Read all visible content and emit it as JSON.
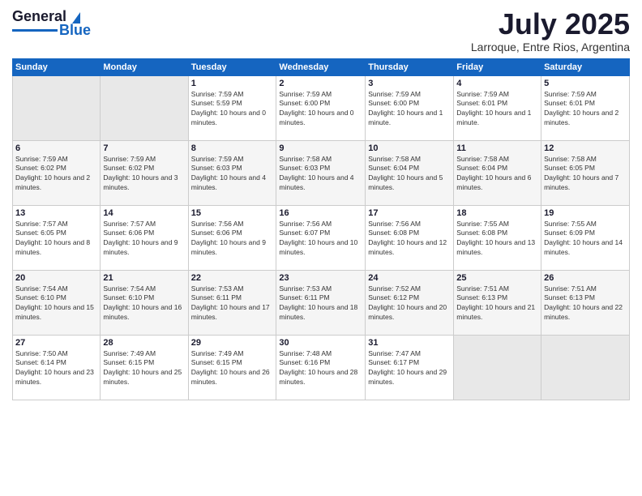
{
  "header": {
    "logo_general": "General",
    "logo_blue": "Blue",
    "month_title": "July 2025",
    "location": "Larroque, Entre Rios, Argentina"
  },
  "calendar": {
    "headers": [
      "Sunday",
      "Monday",
      "Tuesday",
      "Wednesday",
      "Thursday",
      "Friday",
      "Saturday"
    ],
    "weeks": [
      [
        {
          "day": "",
          "sunrise": "",
          "sunset": "",
          "daylight": ""
        },
        {
          "day": "",
          "sunrise": "",
          "sunset": "",
          "daylight": ""
        },
        {
          "day": "1",
          "sunrise": "Sunrise: 7:59 AM",
          "sunset": "Sunset: 5:59 PM",
          "daylight": "Daylight: 10 hours and 0 minutes."
        },
        {
          "day": "2",
          "sunrise": "Sunrise: 7:59 AM",
          "sunset": "Sunset: 6:00 PM",
          "daylight": "Daylight: 10 hours and 0 minutes."
        },
        {
          "day": "3",
          "sunrise": "Sunrise: 7:59 AM",
          "sunset": "Sunset: 6:00 PM",
          "daylight": "Daylight: 10 hours and 1 minute."
        },
        {
          "day": "4",
          "sunrise": "Sunrise: 7:59 AM",
          "sunset": "Sunset: 6:01 PM",
          "daylight": "Daylight: 10 hours and 1 minute."
        },
        {
          "day": "5",
          "sunrise": "Sunrise: 7:59 AM",
          "sunset": "Sunset: 6:01 PM",
          "daylight": "Daylight: 10 hours and 2 minutes."
        }
      ],
      [
        {
          "day": "6",
          "sunrise": "Sunrise: 7:59 AM",
          "sunset": "Sunset: 6:02 PM",
          "daylight": "Daylight: 10 hours and 2 minutes."
        },
        {
          "day": "7",
          "sunrise": "Sunrise: 7:59 AM",
          "sunset": "Sunset: 6:02 PM",
          "daylight": "Daylight: 10 hours and 3 minutes."
        },
        {
          "day": "8",
          "sunrise": "Sunrise: 7:59 AM",
          "sunset": "Sunset: 6:03 PM",
          "daylight": "Daylight: 10 hours and 4 minutes."
        },
        {
          "day": "9",
          "sunrise": "Sunrise: 7:58 AM",
          "sunset": "Sunset: 6:03 PM",
          "daylight": "Daylight: 10 hours and 4 minutes."
        },
        {
          "day": "10",
          "sunrise": "Sunrise: 7:58 AM",
          "sunset": "Sunset: 6:04 PM",
          "daylight": "Daylight: 10 hours and 5 minutes."
        },
        {
          "day": "11",
          "sunrise": "Sunrise: 7:58 AM",
          "sunset": "Sunset: 6:04 PM",
          "daylight": "Daylight: 10 hours and 6 minutes."
        },
        {
          "day": "12",
          "sunrise": "Sunrise: 7:58 AM",
          "sunset": "Sunset: 6:05 PM",
          "daylight": "Daylight: 10 hours and 7 minutes."
        }
      ],
      [
        {
          "day": "13",
          "sunrise": "Sunrise: 7:57 AM",
          "sunset": "Sunset: 6:05 PM",
          "daylight": "Daylight: 10 hours and 8 minutes."
        },
        {
          "day": "14",
          "sunrise": "Sunrise: 7:57 AM",
          "sunset": "Sunset: 6:06 PM",
          "daylight": "Daylight: 10 hours and 9 minutes."
        },
        {
          "day": "15",
          "sunrise": "Sunrise: 7:56 AM",
          "sunset": "Sunset: 6:06 PM",
          "daylight": "Daylight: 10 hours and 9 minutes."
        },
        {
          "day": "16",
          "sunrise": "Sunrise: 7:56 AM",
          "sunset": "Sunset: 6:07 PM",
          "daylight": "Daylight: 10 hours and 10 minutes."
        },
        {
          "day": "17",
          "sunrise": "Sunrise: 7:56 AM",
          "sunset": "Sunset: 6:08 PM",
          "daylight": "Daylight: 10 hours and 12 minutes."
        },
        {
          "day": "18",
          "sunrise": "Sunrise: 7:55 AM",
          "sunset": "Sunset: 6:08 PM",
          "daylight": "Daylight: 10 hours and 13 minutes."
        },
        {
          "day": "19",
          "sunrise": "Sunrise: 7:55 AM",
          "sunset": "Sunset: 6:09 PM",
          "daylight": "Daylight: 10 hours and 14 minutes."
        }
      ],
      [
        {
          "day": "20",
          "sunrise": "Sunrise: 7:54 AM",
          "sunset": "Sunset: 6:10 PM",
          "daylight": "Daylight: 10 hours and 15 minutes."
        },
        {
          "day": "21",
          "sunrise": "Sunrise: 7:54 AM",
          "sunset": "Sunset: 6:10 PM",
          "daylight": "Daylight: 10 hours and 16 minutes."
        },
        {
          "day": "22",
          "sunrise": "Sunrise: 7:53 AM",
          "sunset": "Sunset: 6:11 PM",
          "daylight": "Daylight: 10 hours and 17 minutes."
        },
        {
          "day": "23",
          "sunrise": "Sunrise: 7:53 AM",
          "sunset": "Sunset: 6:11 PM",
          "daylight": "Daylight: 10 hours and 18 minutes."
        },
        {
          "day": "24",
          "sunrise": "Sunrise: 7:52 AM",
          "sunset": "Sunset: 6:12 PM",
          "daylight": "Daylight: 10 hours and 20 minutes."
        },
        {
          "day": "25",
          "sunrise": "Sunrise: 7:51 AM",
          "sunset": "Sunset: 6:13 PM",
          "daylight": "Daylight: 10 hours and 21 minutes."
        },
        {
          "day": "26",
          "sunrise": "Sunrise: 7:51 AM",
          "sunset": "Sunset: 6:13 PM",
          "daylight": "Daylight: 10 hours and 22 minutes."
        }
      ],
      [
        {
          "day": "27",
          "sunrise": "Sunrise: 7:50 AM",
          "sunset": "Sunset: 6:14 PM",
          "daylight": "Daylight: 10 hours and 23 minutes."
        },
        {
          "day": "28",
          "sunrise": "Sunrise: 7:49 AM",
          "sunset": "Sunset: 6:15 PM",
          "daylight": "Daylight: 10 hours and 25 minutes."
        },
        {
          "day": "29",
          "sunrise": "Sunrise: 7:49 AM",
          "sunset": "Sunset: 6:15 PM",
          "daylight": "Daylight: 10 hours and 26 minutes."
        },
        {
          "day": "30",
          "sunrise": "Sunrise: 7:48 AM",
          "sunset": "Sunset: 6:16 PM",
          "daylight": "Daylight: 10 hours and 28 minutes."
        },
        {
          "day": "31",
          "sunrise": "Sunrise: 7:47 AM",
          "sunset": "Sunset: 6:17 PM",
          "daylight": "Daylight: 10 hours and 29 minutes."
        },
        {
          "day": "",
          "sunrise": "",
          "sunset": "",
          "daylight": ""
        },
        {
          "day": "",
          "sunrise": "",
          "sunset": "",
          "daylight": ""
        }
      ]
    ]
  }
}
